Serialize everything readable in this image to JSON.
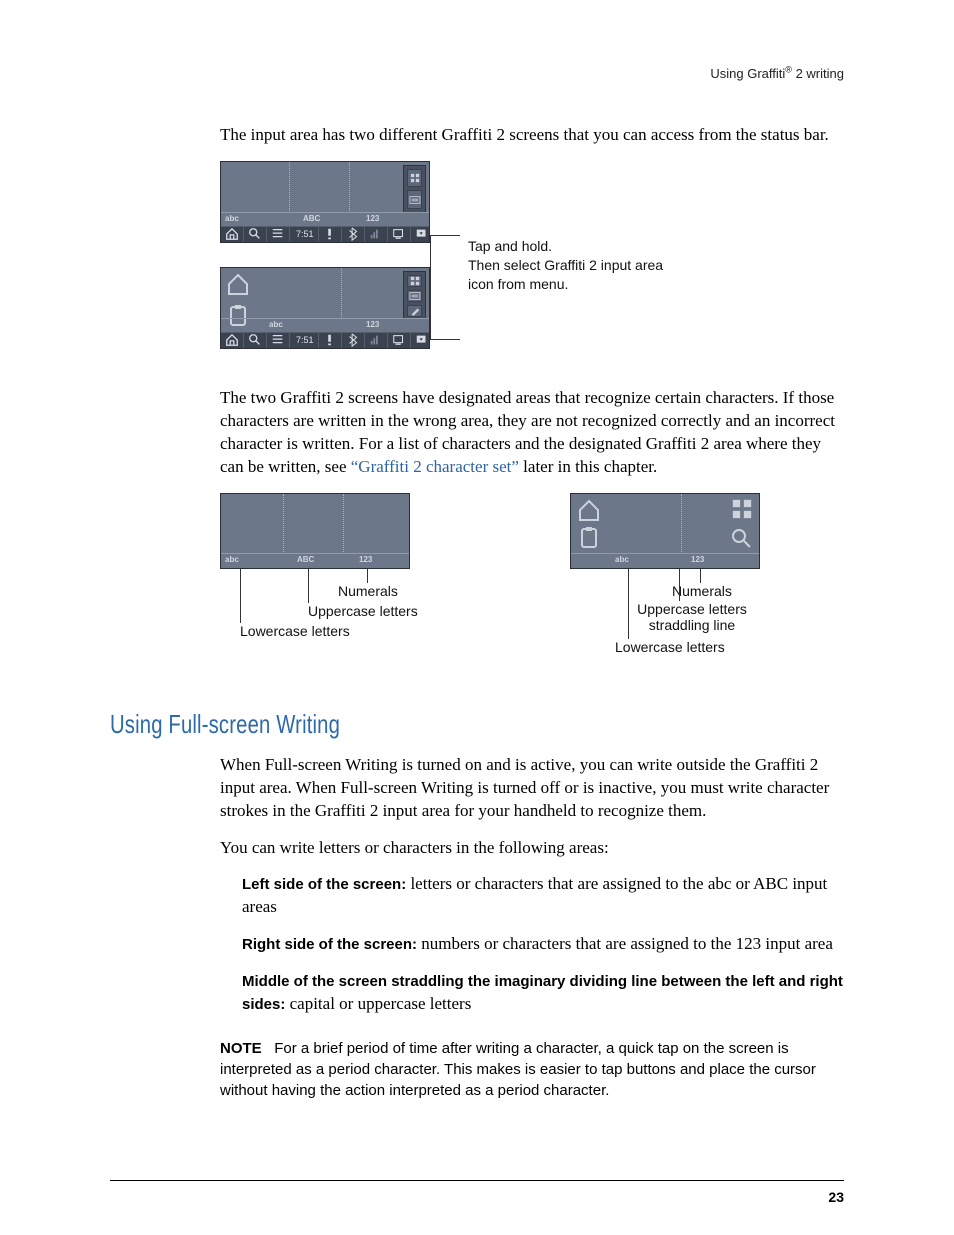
{
  "header": {
    "prefix": "Using Graffiti",
    "reg_mark": "®",
    "suffix": " 2 writing"
  },
  "page_number": "23",
  "intro_para": "The input area has two different Graffiti 2 screens that you can access from the status bar.",
  "figure1": {
    "callout": "Tap and hold.\nThen select Graffiti 2 input area icon from menu.",
    "input_labels_mode1": {
      "abc": "abc",
      "ABC": "ABC",
      "num": "123"
    },
    "input_labels_mode2": {
      "abc": "abc",
      "num": "123"
    },
    "status_bar": {
      "time": "7:51",
      "icons": [
        "home-icon",
        "search-icon",
        "menu-icon",
        "time-text",
        "alert-icon",
        "bluetooth-icon",
        "signal-icon",
        "screen-icon",
        "dropdown-icon"
      ]
    },
    "right_panel_icons": [
      "apps-grid-icon",
      "keyboard-icon",
      "stylus-icon"
    ],
    "left_big_icons": [
      "home-outline-icon",
      "clipboard-icon"
    ]
  },
  "para2_pre": "The two Graffiti 2 screens have designated areas that recognize certain characters. If those characters are written in the wrong area, they are not recognized correctly and an incorrect character is written. For a list of characters and the designated Graffiti 2 area where they can be written, see ",
  "para2_link": "“Graffiti 2 character set”",
  "para2_post": " later in this chapter.",
  "figure2": {
    "left": {
      "input_labels": {
        "abc": "abc",
        "ABC": "ABC",
        "num": "123"
      },
      "tags": {
        "numerals": "Numerals",
        "uppercase": "Uppercase letters",
        "lowercase": "Lowercase letters"
      }
    },
    "right": {
      "input_labels": {
        "abc": "abc",
        "num": "123"
      },
      "corner_icons": [
        "home-outline-icon",
        "clipboard-icon",
        "apps-grid-icon",
        "find-outline-icon"
      ],
      "tags": {
        "numerals": "Numerals",
        "uppercase": "Uppercase letters straddling line",
        "lowercase": "Lowercase letters"
      }
    }
  },
  "section_heading": "Using Full-screen Writing",
  "para3": "When Full-screen Writing is turned on and is active, you can write outside the Graffiti 2 input area. When Full-screen Writing is turned off or is inactive, you must write character strokes in the Graffiti 2 input area for your handheld to recognize them.",
  "para4": "You can write letters or characters in the following areas:",
  "items": [
    {
      "lead": "Left side of the screen:",
      "body": " letters or characters that are assigned to the abc or ABC input areas"
    },
    {
      "lead": "Right side of the screen:",
      "body": " numbers or characters that are assigned to the 123 input area"
    },
    {
      "lead": "Middle of the screen straddling the imaginary dividing line between the left and right sides:",
      "body": " capital or uppercase letters"
    }
  ],
  "note": {
    "lead": "NOTE",
    "body": "For a brief period of time after writing a character, a quick tap on the screen is interpreted as a period character. This makes is easier to tap buttons and place the cursor without having the action interpreted as a period character."
  }
}
